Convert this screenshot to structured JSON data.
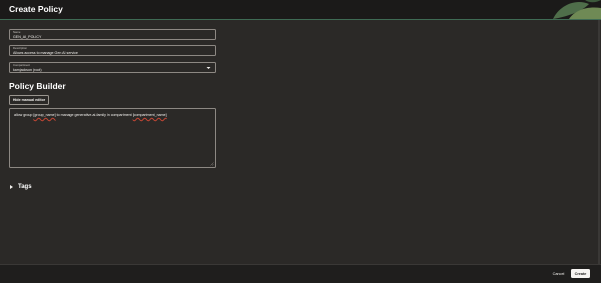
{
  "header": {
    "title": "Create Policy"
  },
  "form": {
    "name": {
      "label": "Name",
      "value": "GEN_AI_POLICY"
    },
    "description": {
      "label": "Description",
      "value": "Allows access to manage Gen AI service"
    },
    "compartment": {
      "label": "Compartment",
      "value": "kamjackson (root)"
    }
  },
  "policy_builder": {
    "title": "Policy Builder",
    "toggle_label": "Hide manual editor",
    "statement_prefix": "allow group ",
    "group_token": "[group_name]",
    "statement_middle": " to manage generative-ai-family in compartment ",
    "compartment_token": "[compartment_name]"
  },
  "tags": {
    "label": "Tags"
  },
  "footer": {
    "cancel_label": "Cancel",
    "create_label": "Create"
  },
  "colors": {
    "background": "#2b2927",
    "header": "#1b1a19",
    "accent_green": "#3f6b54",
    "primary_button": "#f7f5f2",
    "error_underline": "#c74634"
  }
}
